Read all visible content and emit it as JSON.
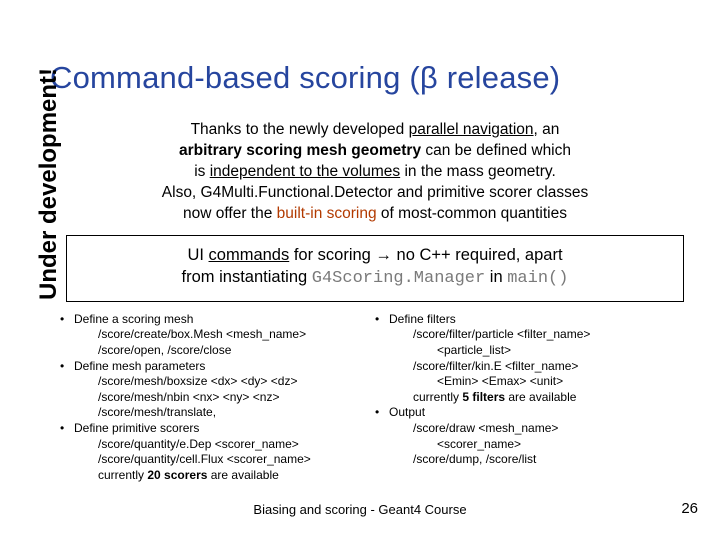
{
  "title": "Command-based scoring (β release)",
  "sidebar": "Under development!",
  "intro": {
    "l1a": "Thanks to the newly developed ",
    "l1b": "parallel navigation",
    "l1c": ", an",
    "l2a": "arbitrary scoring mesh geometry",
    "l2b": " can be defined which",
    "l3a": "is ",
    "l3b": "independent to the volumes",
    "l3c": " in the mass geometry.",
    "l4": "Also, G4Multi.Functional.Detector and primitive scorer classes",
    "l5a": "now offer the ",
    "l5b": "built-in scoring",
    "l5c": " of most-common quantities"
  },
  "uibox": {
    "l1a": "UI ",
    "l1b": "commands",
    "l1c": " for scoring → no C++ required, apart",
    "l2a": "from instantiating ",
    "l2code": "G4Scoring.Manager",
    "l2b": " in ",
    "l2code2": "main()"
  },
  "left": {
    "i1": {
      "head": "Define a scoring mesh",
      "s1": "/score/create/box.Mesh <mesh_name>",
      "s2": "/score/open, /score/close"
    },
    "i2": {
      "head": "Define mesh parameters",
      "s1": "/score/mesh/boxsize <dx> <dy> <dz>",
      "s2": "/score/mesh/nbin <nx> <ny> <nz>",
      "s3": "/score/mesh/translate,"
    },
    "i3": {
      "head": "Define primitive scorers",
      "s1": "/score/quantity/e.Dep <scorer_name>",
      "s2": "/score/quantity/cell.Flux <scorer_name>",
      "s3a": "currently ",
      "s3b": "20 scorers",
      "s3c": " are available"
    }
  },
  "right": {
    "i1": {
      "head": "Define filters",
      "s1": "/score/filter/particle <filter_name>",
      "s1b": "<particle_list>",
      "s2": "/score/filter/kin.E <filter_name>",
      "s2b": "<Emin>    <Emax> <unit>",
      "s3a": "currently ",
      "s3b": "5 filters",
      "s3c": " are available"
    },
    "i2": {
      "head": "Output",
      "s1": "/score/draw <mesh_name>",
      "s1b": "<scorer_name>",
      "s2": "/score/dump, /score/list"
    }
  },
  "footer": "Biasing and scoring - Geant4 Course",
  "pagenum": "26"
}
